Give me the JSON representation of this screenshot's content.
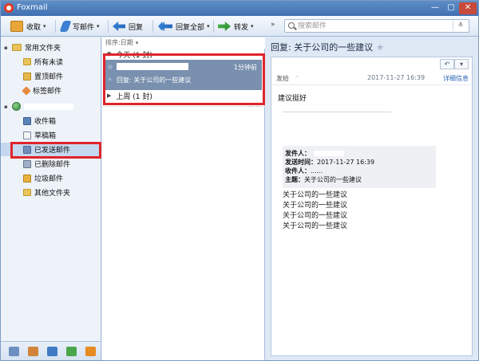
{
  "window": {
    "title": "Foxmail",
    "min_glyph": "—",
    "max_glyph": "▢",
    "close_glyph": "✕"
  },
  "toolbar": {
    "receive": "收取",
    "write": "写邮件",
    "reply": "回复",
    "reply_all": "回复全部",
    "forward": "转发",
    "more": "»",
    "dropdown_arrow": "▾"
  },
  "search": {
    "placeholder": "搜索邮件",
    "dropdown_glyph": "≚"
  },
  "sidebar": {
    "common_folders": {
      "label": "常用文件夹",
      "toggle": "▪",
      "items": [
        {
          "label": "所有未读",
          "icon": "folder-icon"
        },
        {
          "label": "置顶邮件",
          "icon": "pin-icon"
        },
        {
          "label": "标签邮件",
          "icon": "tag-icon"
        }
      ]
    },
    "account": {
      "toggle": "▪",
      "items": [
        {
          "label": "收件箱",
          "icon": "inbox-icon"
        },
        {
          "label": "草稿箱",
          "icon": "drafts-icon"
        },
        {
          "label": "已发送邮件",
          "icon": "sent-icon",
          "selected": true
        },
        {
          "label": "已删除邮件",
          "icon": "trash-icon"
        },
        {
          "label": "垃圾邮件",
          "icon": "spam-icon"
        },
        {
          "label": "其他文件夹",
          "icon": "folder-icon"
        }
      ]
    },
    "bottom_tabs": [
      "mail-icon",
      "contacts-icon",
      "calendar-icon",
      "notes-icon",
      "rss-icon"
    ]
  },
  "message_list": {
    "sort_label": "排序:日期",
    "sort_arrow": "▾",
    "groups": [
      {
        "label": "今天 (1 封)",
        "toggle": "▼"
      },
      {
        "label": "上周 (1 封)",
        "toggle": "▶"
      }
    ],
    "selected_message": {
      "time": "1分钟前",
      "subject": "回复: 关于公司的一些建议"
    },
    "star_glyph": "★",
    "hint": "— —"
  },
  "reader": {
    "subject": "回复: 关于公司的一些建议",
    "star": "★",
    "reply_glyph": "↶",
    "menu_glyph": "▾",
    "sent_to_label": "发给",
    "sent_to_dot": "·",
    "date": "2017-11-27 16:39",
    "details_link": "详细信息",
    "body_first_line": "建议挺好",
    "quote": {
      "from_key": "发件人：",
      "time_key": "发送时间：",
      "time_value": "2017-11-27 16:39",
      "to_key": "收件人：",
      "to_value": "......",
      "subject_key": "主题：",
      "subject_value": "关于公司的一些建议"
    },
    "quoted_lines": [
      "关于公司的一些建议",
      "关于公司的一些建议",
      "关于公司的一些建议",
      "关于公司的一些建议"
    ]
  },
  "colors": {
    "accent_selection": "#7990ae",
    "highlight_border": "#e0242b",
    "link": "#2b66b8"
  }
}
